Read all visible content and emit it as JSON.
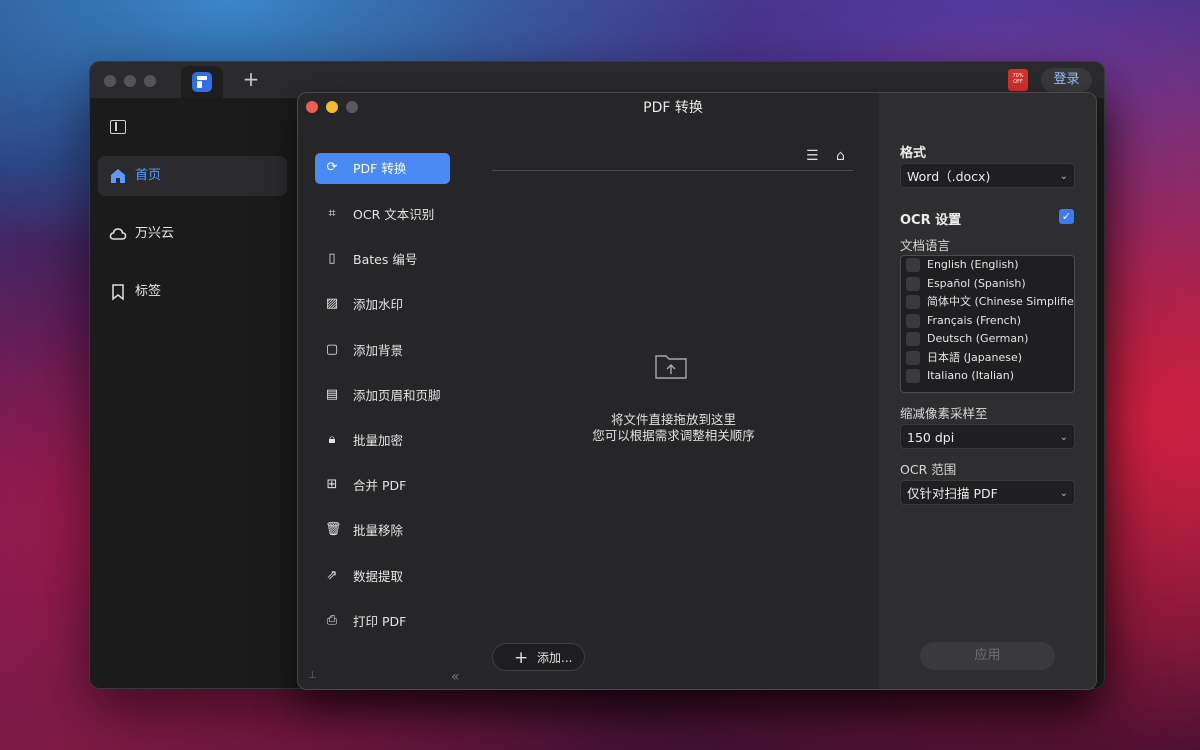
{
  "app": {
    "login_label": "登录",
    "promo_text": "70% OFF",
    "accent": "#4a8af4"
  },
  "sidebar": {
    "items": [
      {
        "label": "首页",
        "icon": "home-icon",
        "active": true
      },
      {
        "label": "万兴云",
        "icon": "cloud-icon"
      },
      {
        "label": "标签",
        "icon": "bookmark-icon"
      }
    ]
  },
  "dialog": {
    "title": "PDF 转换",
    "tools": [
      {
        "label": "PDF 转换",
        "icon": "convert-icon",
        "active": true
      },
      {
        "label": "OCR 文本识别",
        "icon": "ocr-icon"
      },
      {
        "label": "Bates 编号",
        "icon": "bates-icon"
      },
      {
        "label": "添加水印",
        "icon": "watermark-icon"
      },
      {
        "label": "添加背景",
        "icon": "background-icon"
      },
      {
        "label": "添加页眉和页脚",
        "icon": "header-footer-icon"
      },
      {
        "label": "批量加密",
        "icon": "lock-icon"
      },
      {
        "label": "合并 PDF",
        "icon": "merge-icon"
      },
      {
        "label": "批量移除",
        "icon": "trash-icon"
      },
      {
        "label": "数据提取",
        "icon": "extract-icon"
      },
      {
        "label": "打印 PDF",
        "icon": "print-icon"
      }
    ],
    "drop_hint_line1": "将文件直接拖放到这里",
    "drop_hint_line2": "您可以根据需求调整相关顺序",
    "add_label": "添加..."
  },
  "settings": {
    "format_heading": "格式",
    "format_value": "Word（.docx)",
    "ocr_heading": "OCR 设置",
    "ocr_enabled": true,
    "doc_lang_label": "文档语言",
    "languages": [
      "English (English)",
      "Español (Spanish)",
      "简体中文 (Chinese Simplified)",
      "Français (French)",
      "Deutsch (German)",
      "日本語 (Japanese)",
      "Italiano (Italian)"
    ],
    "downsample_label": "缩减像素采样至",
    "downsample_value": "150 dpi",
    "ocr_range_label": "OCR 范围",
    "ocr_range_value": "仅针对扫描 PDF",
    "apply_label": "应用"
  }
}
